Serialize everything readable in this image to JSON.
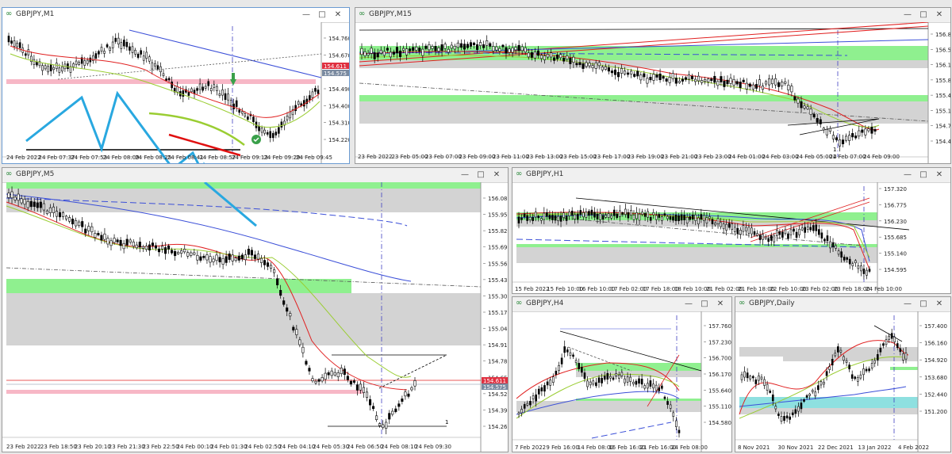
{
  "windows": {
    "m1": {
      "title": "GBPJPY,M1",
      "price_labels": [
        "154.760",
        "154.670",
        "154.580",
        "154.490",
        "154.400",
        "154.310",
        "154.220"
      ],
      "tag_bid": "154.611",
      "tag_ask": "154.575",
      "time_labels": [
        "24 Feb 2022",
        "24 Feb 07:37",
        "24 Feb 07:53",
        "24 Feb 08:09",
        "24 Feb 08:25",
        "24 Feb 08:41",
        "24 Feb 08:57",
        "24 Feb 09:13",
        "24 Feb 09:29",
        "24 Feb 09:45"
      ]
    },
    "m15": {
      "title": "GBPJPY,M15",
      "price_labels": [
        "156.850",
        "156.505",
        "156.160",
        "155.815",
        "155.470",
        "155.125",
        "154.780",
        "154.435"
      ],
      "marks": [
        "1",
        "2"
      ],
      "time_labels": [
        "23 Feb 2022",
        "23 Feb 05:00",
        "23 Feb 07:00",
        "23 Feb 09:00",
        "23 Feb 11:00",
        "23 Feb 13:00",
        "23 Feb 15:00",
        "23 Feb 17:00",
        "23 Feb 19:00",
        "23 Feb 21:00",
        "23 Feb 23:00",
        "24 Feb 01:00",
        "24 Feb 03:00",
        "24 Feb 05:00",
        "24 Feb 07:00",
        "24 Feb 09:00"
      ]
    },
    "m5": {
      "title": "GBPJPY,M5",
      "price_labels": [
        "156.080",
        "155.950",
        "155.820",
        "155.690",
        "155.560",
        "155.430",
        "155.300",
        "155.170",
        "155.040",
        "154.910",
        "154.780",
        "154.650",
        "154.520",
        "154.390",
        "154.260"
      ],
      "tag_bid": "154.611",
      "tag_ask": "154.575",
      "marks": [
        "1"
      ],
      "time_labels": [
        "23 Feb 2022",
        "23 Feb 18:50",
        "23 Feb 20:10",
        "23 Feb 21:30",
        "23 Feb 22:50",
        "24 Feb 00:10",
        "24 Feb 01:30",
        "24 Feb 02:50",
        "24 Feb 04:10",
        "24 Feb 05:30",
        "24 Feb 06:50",
        "24 Feb 08:10",
        "24 Feb 09:30"
      ]
    },
    "h1": {
      "title": "GBPJPY,H1",
      "price_labels": [
        "157.320",
        "156.775",
        "156.230",
        "155.685",
        "155.140",
        "154.595"
      ],
      "time_labels": [
        "15 Feb 2022",
        "15 Feb 10:00",
        "16 Feb 10:00",
        "17 Feb 02:00",
        "17 Feb 18:00",
        "18 Feb 10:00",
        "21 Feb 02:00",
        "21 Feb 18:00",
        "22 Feb 10:00",
        "23 Feb 02:00",
        "23 Feb 18:00",
        "24 Feb 10:00"
      ]
    },
    "h4": {
      "title": "GBPJPY,H4",
      "price_labels": [
        "157.760",
        "157.230",
        "156.700",
        "156.170",
        "155.640",
        "155.110",
        "154.580"
      ],
      "time_labels": [
        "7 Feb 2022",
        "9 Feb 16:00",
        "14 Feb 08:00",
        "16 Feb 16:00",
        "21 Feb 16:00",
        "24 Feb 08:00"
      ]
    },
    "daily": {
      "title": "GBPJPY,Daily",
      "price_labels": [
        "157.400",
        "156.160",
        "154.920",
        "153.680",
        "152.440",
        "151.200"
      ],
      "time_labels": [
        "8 Nov 2021",
        "30 Nov 2021",
        "22 Dec 2021",
        "13 Jan 2022",
        "4 Feb 2022"
      ]
    }
  },
  "colors": {
    "bear_candle": "#000000",
    "bull_candle": "#ffffff",
    "green_zone": "#8ff08f",
    "grey_zone": "#d3d3d3",
    "pink_zone": "#f7b7c6",
    "cyan_zone": "#8ee0e0",
    "ma_fast": "#e02020",
    "ma_mid": "#9acd32",
    "ma_slow": "#3b4fd8",
    "annotation_blue": "#29a8e0",
    "annotation_green": "#9acd32",
    "annotation_red": "#e01010",
    "bid_tag": "#e03040",
    "ask_tag": "#7a8aa0"
  },
  "icons": {
    "window": "chart-window-icon",
    "minimize": "minimize-icon",
    "maximize": "maximize-icon",
    "close": "close-icon",
    "checkmark": "check-circle-icon",
    "arrow": "down-arrow-icon"
  }
}
